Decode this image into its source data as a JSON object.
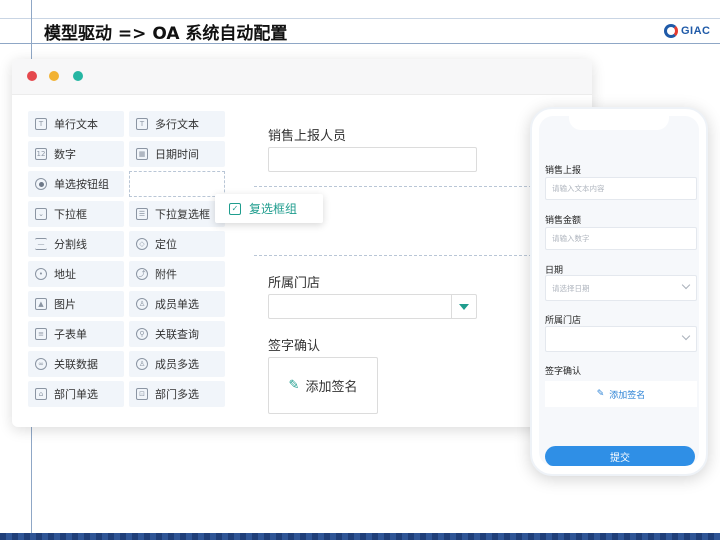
{
  "slide": {
    "title": "模型驱动 => OA 系统自动配置",
    "logo_text": "GIAC"
  },
  "palette": {
    "left": [
      {
        "label": "单行文本",
        "icon": "text-box-icon"
      },
      {
        "label": "数字",
        "icon": "number-icon"
      },
      {
        "label": "单选按钮组",
        "icon": "radio-icon"
      },
      {
        "label": "下拉框",
        "icon": "dropdown-icon"
      },
      {
        "label": "分割线",
        "icon": "divider-icon"
      },
      {
        "label": "地址",
        "icon": "location-pin-icon"
      },
      {
        "label": "图片",
        "icon": "image-icon"
      },
      {
        "label": "子表单",
        "icon": "subform-icon"
      },
      {
        "label": "关联数据",
        "icon": "link-data-icon"
      },
      {
        "label": "部门单选",
        "icon": "department-icon"
      }
    ],
    "right": [
      {
        "label": "多行文本",
        "icon": "textarea-icon"
      },
      {
        "label": "日期时间",
        "icon": "calendar-icon"
      },
      {
        "label": "",
        "icon": ""
      },
      {
        "label": "下拉复选框",
        "icon": "multi-dropdown-icon"
      },
      {
        "label": "定位",
        "icon": "locate-icon"
      },
      {
        "label": "附件",
        "icon": "attachment-icon"
      },
      {
        "label": "成员单选",
        "icon": "member-icon"
      },
      {
        "label": "关联查询",
        "icon": "query-icon"
      },
      {
        "label": "成员多选",
        "icon": "members-icon"
      },
      {
        "label": "部门多选",
        "icon": "departments-icon"
      }
    ],
    "dragging": {
      "label": "复选框组",
      "icon": "checkbox-icon"
    }
  },
  "form": {
    "field1_label": "销售上报人员",
    "field2_label": "所属门店",
    "field3_label": "签字确认",
    "sign_button": "添加签名"
  },
  "mobile": {
    "fields": [
      {
        "label": "销售上报",
        "placeholder": "请输入文本内容"
      },
      {
        "label": "销售金额",
        "placeholder": "请输入数字"
      },
      {
        "label": "日期",
        "placeholder": "请选择日期"
      },
      {
        "label": "所属门店",
        "placeholder": ""
      }
    ],
    "sign_label": "签字确认",
    "sign_button": "添加签名",
    "submit": "提交"
  }
}
